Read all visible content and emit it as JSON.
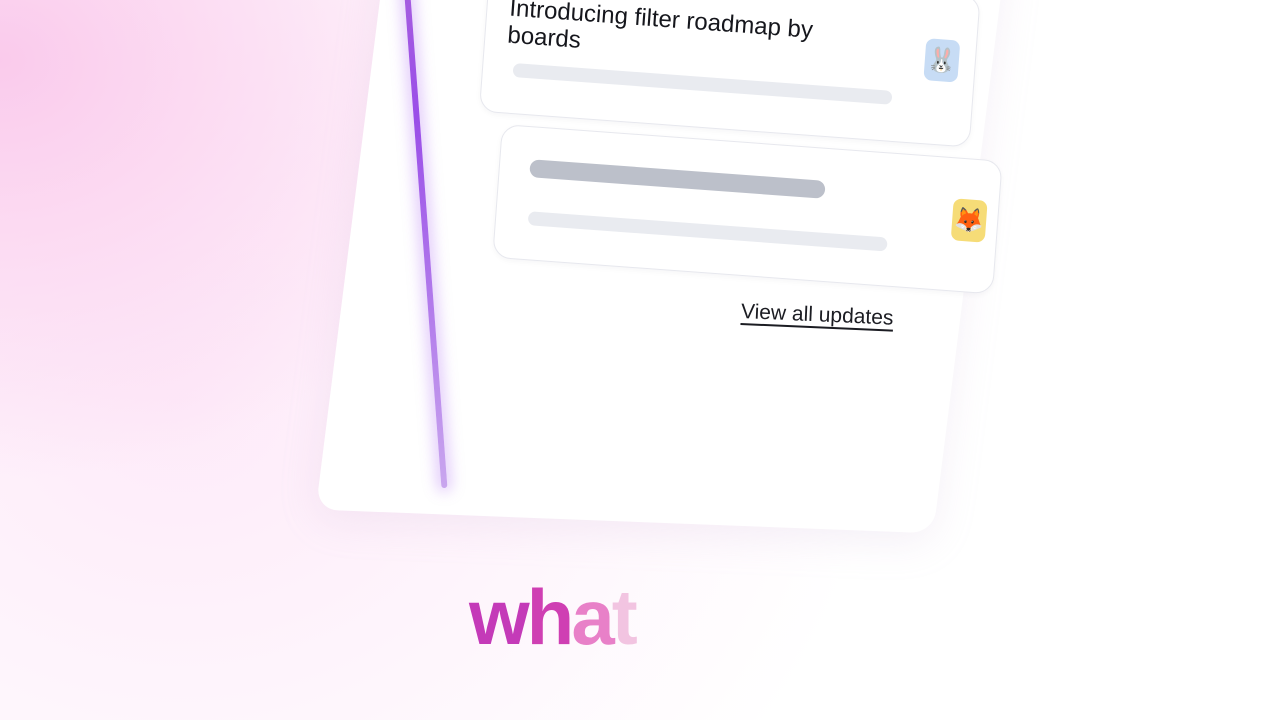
{
  "updates": {
    "cards": [
      {
        "title": "Introducing filter roadmap by boards",
        "avatar_icon": "rabbit-icon",
        "avatar_glyph": "🐰",
        "avatar_color": "#c7dcf5"
      },
      {
        "title": "",
        "avatar_icon": "fox-icon",
        "avatar_glyph": "🦊",
        "avatar_color": "#f6dc77"
      }
    ],
    "view_all_label": "View all updates"
  },
  "headline": {
    "letters": [
      "w",
      "h",
      "a",
      "t"
    ],
    "colors": [
      "#c43ab8",
      "#cf3fb3",
      "#e880c8",
      "#f2c4e1"
    ]
  },
  "colors": {
    "panel_edge": "#9a4ee8",
    "background_pink": "#fac8eb"
  }
}
